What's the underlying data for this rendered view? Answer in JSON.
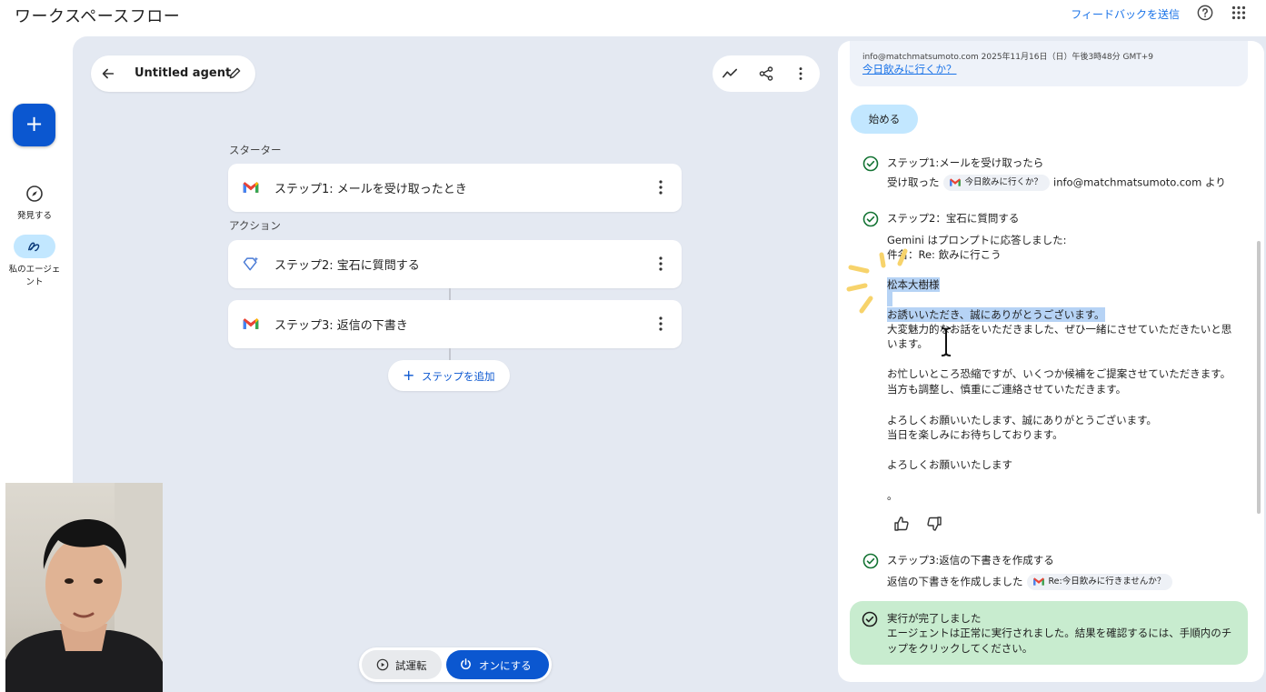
{
  "app": {
    "title": "ワークスペースフロー"
  },
  "topbar": {
    "feedback_label": "フィードバックを送信"
  },
  "rail": {
    "new_label": "+",
    "discover_label": "発見する",
    "agents_label": "私のエージェント"
  },
  "agent": {
    "name": "Untitled agent"
  },
  "flow": {
    "starter_label": "スターター",
    "action_label": "アクション",
    "steps": [
      {
        "label": "ステップ1: メールを受け取ったとき",
        "icon": "gmail-icon"
      },
      {
        "label": "ステップ2: 宝石に質問する",
        "icon": "gem-icon"
      },
      {
        "label": "ステップ3: 返信の下書き",
        "icon": "gmail-icon"
      }
    ],
    "add_step_label": "ステップを追加"
  },
  "bottom": {
    "test_label": "試運転",
    "on_label": "オンにする"
  },
  "panel": {
    "email_meta": "info@matchmatsumoto.com 2025年11月16日（日）午後3時48分 GMT+9",
    "email_subject": "今日飲みに行くか？",
    "start_label": "始める",
    "step1": {
      "title": "ステップ1:メールを受け取ったら",
      "prefix": "受け取った",
      "chip": "今日飲みに行くか？",
      "suffix": "info@matchmatsumoto.com より"
    },
    "step2": {
      "title": "ステップ2：宝石に質問する",
      "lines": [
        "Gemini はプロンプトに応答しました:",
        "件名：Re: 飲みに行こう",
        "松本大樹様",
        "お誘いいただき、誠にありがとうございます。",
        "大変魅力的なお話をいただきました、ぜひ一緒にさせていただきたいと思",
        "います。",
        "お忙しいところ恐縮ですが、いくつか候補をご提案させていただきます。",
        "当方も調整し、慎重にご連絡させていただきます。",
        "よろしくお願いいたします、誠にありがとうございます。",
        "当日を楽しみにお待ちしております。",
        "よろしくお願いいたします",
        "。"
      ]
    },
    "step3": {
      "title": "ステップ3:返信の下書きを作成する",
      "prefix": "返信の下書きを作成しました",
      "chip": "Re:今日飲みに行きませんか？"
    },
    "done": {
      "title": "実行が完了しました",
      "body": "エージェントは正常に実行されました。結果を確認するには、手順内のチップをクリックしてください。"
    }
  },
  "colors": {
    "accent": "#0b57d0",
    "canvas": "#e4e9f2",
    "success": "#c8eccf",
    "selection": "#b6d3f5"
  }
}
